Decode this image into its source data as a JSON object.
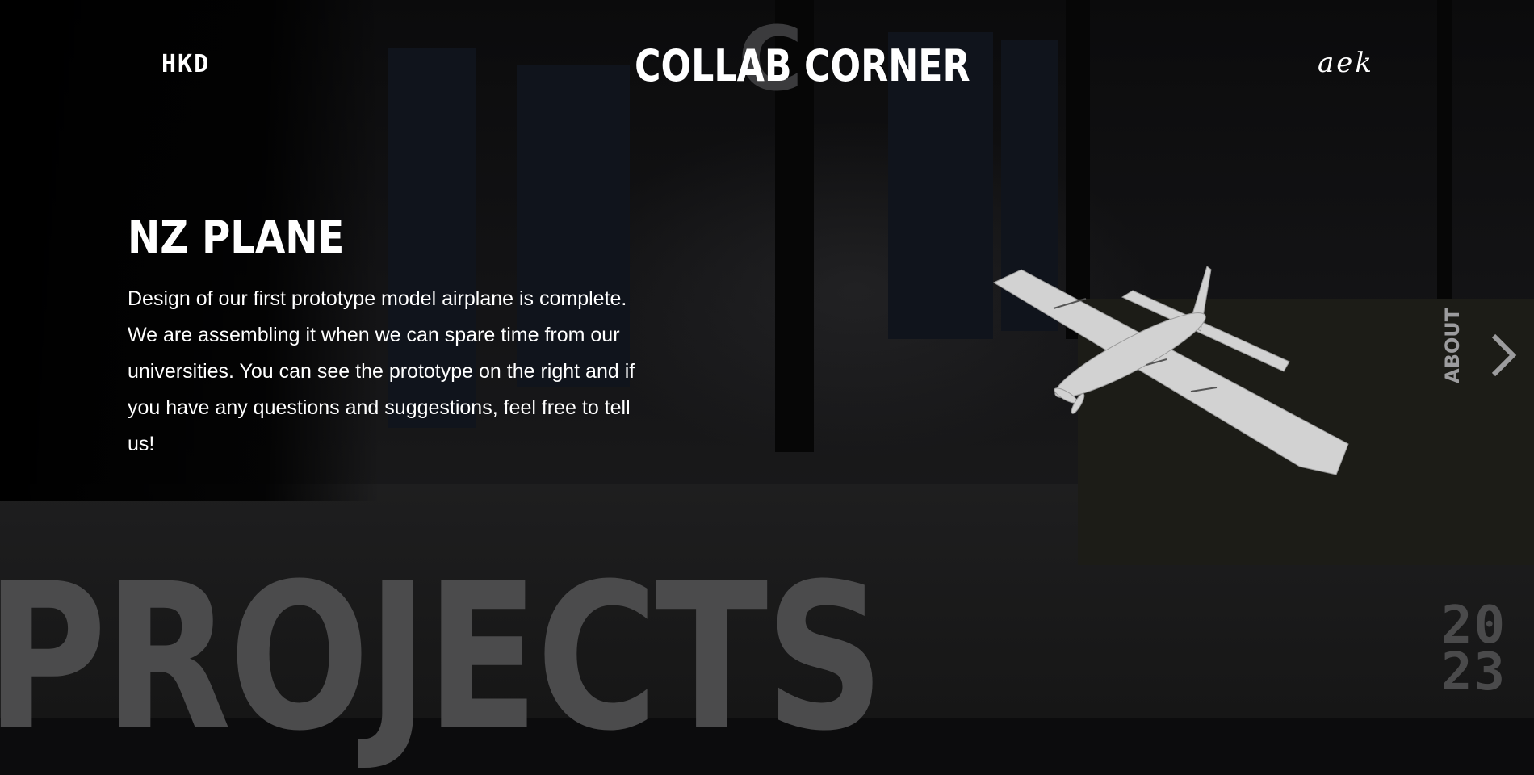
{
  "header": {
    "left_logo": "HKD",
    "brand": "COLLAB CORNER",
    "brand_mark": "C",
    "right_logo": "aek"
  },
  "project": {
    "title": "NZ PLANE",
    "description": "Design of our first prototype model airplane is complete. We are assembling it when we can spare time from our universities. You can see the prototype on the right and if you have any questions and suggestions, feel free to tell us!"
  },
  "nav": {
    "about_label": "ABOUT",
    "next_icon": "chevron-right-icon"
  },
  "section": {
    "big_label": "PROJECTS",
    "year": [
      "20",
      "23"
    ]
  },
  "colors": {
    "background": "#0c0c0d",
    "text": "#ffffff",
    "muted": "#4b4b4c",
    "about": "#9c9c9e"
  }
}
